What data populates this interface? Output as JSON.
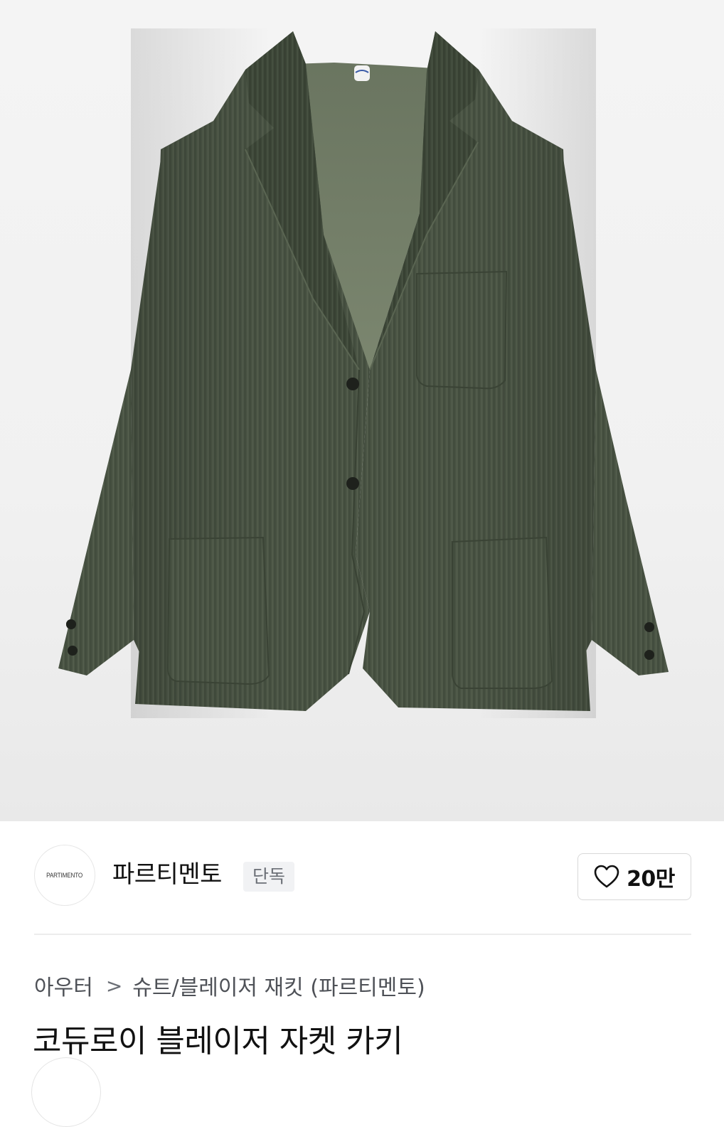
{
  "brand": {
    "logo_text": "PARTIMENTO",
    "name": "파르티멘토",
    "badge": "단독"
  },
  "like": {
    "icon": "heart-outline-icon",
    "count": "20만"
  },
  "breadcrumb": {
    "category": "아우터",
    "separator": ">",
    "subcategory": "슈트/블레이저 재킷 (파르티멘토)"
  },
  "product": {
    "title": "코듀로이 블레이저 자켓 카키",
    "color": "#4a5443"
  },
  "colors": {
    "divider": "#ececec",
    "badge_bg": "#f1f2f4"
  }
}
